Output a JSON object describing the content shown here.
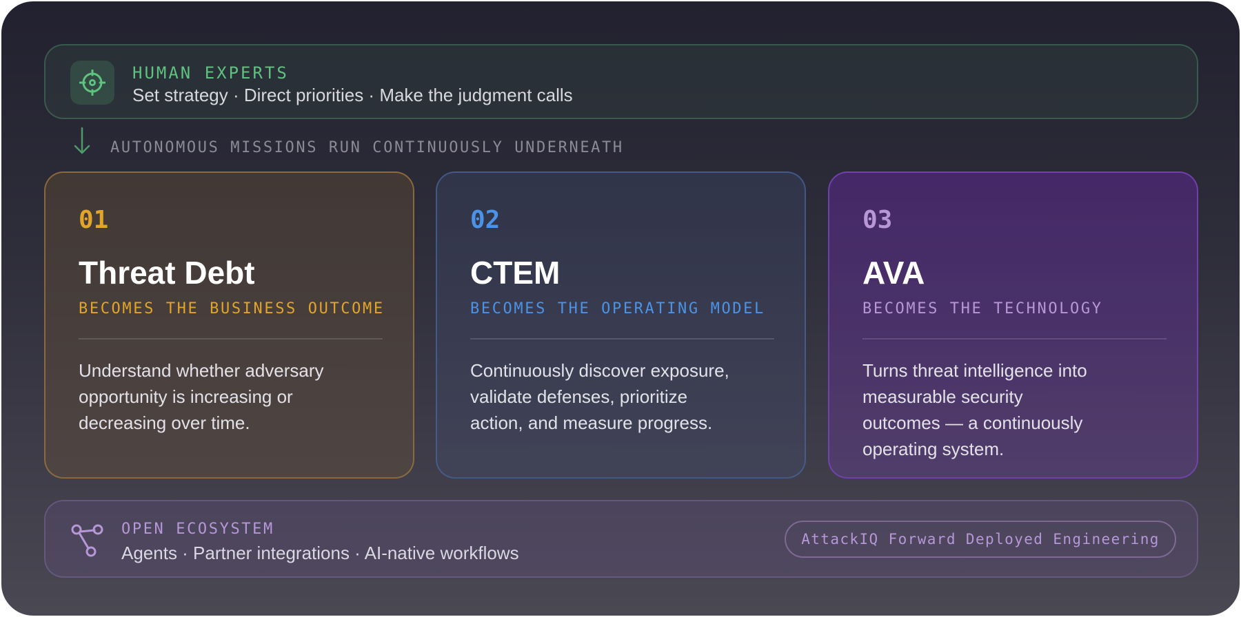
{
  "experts": {
    "label": "HUMAN EXPERTS",
    "subtitle": "Set strategy · Direct priorities · Make the judgment calls",
    "icon": "crosshair-icon"
  },
  "flow": {
    "label": "AUTONOMOUS MISSIONS RUN CONTINUOUSLY UNDERNEATH",
    "icon": "arrow-down-icon"
  },
  "cards": [
    {
      "number": "01",
      "title": "Threat Debt",
      "role": "BECOMES THE BUSINESS OUTCOME",
      "description": "Understand whether adversary opportunity is increasing or decreasing over time.",
      "accent": "#e3a42a"
    },
    {
      "number": "02",
      "title": "CTEM",
      "role": "BECOMES THE OPERATING MODEL",
      "description": "Continuously discover exposure, validate defenses, prioritize action, and measure progress.",
      "accent": "#4b93e6"
    },
    {
      "number": "03",
      "title": "AVA",
      "role": "BECOMES THE TECHNOLOGY",
      "description": "Turns threat intelligence into measurable security outcomes — a continuously operating system.",
      "accent": "#b797d8"
    }
  ],
  "ecosystem": {
    "label": "OPEN ECOSYSTEM",
    "subtitle": "Agents · Partner integrations · AI-native workflows",
    "badge": "AttackIQ Forward Deployed Engineering",
    "icon": "share-nodes-icon"
  },
  "colors": {
    "experts_green": "#5fc27f",
    "ecosystem_purple": "#b797d8"
  }
}
